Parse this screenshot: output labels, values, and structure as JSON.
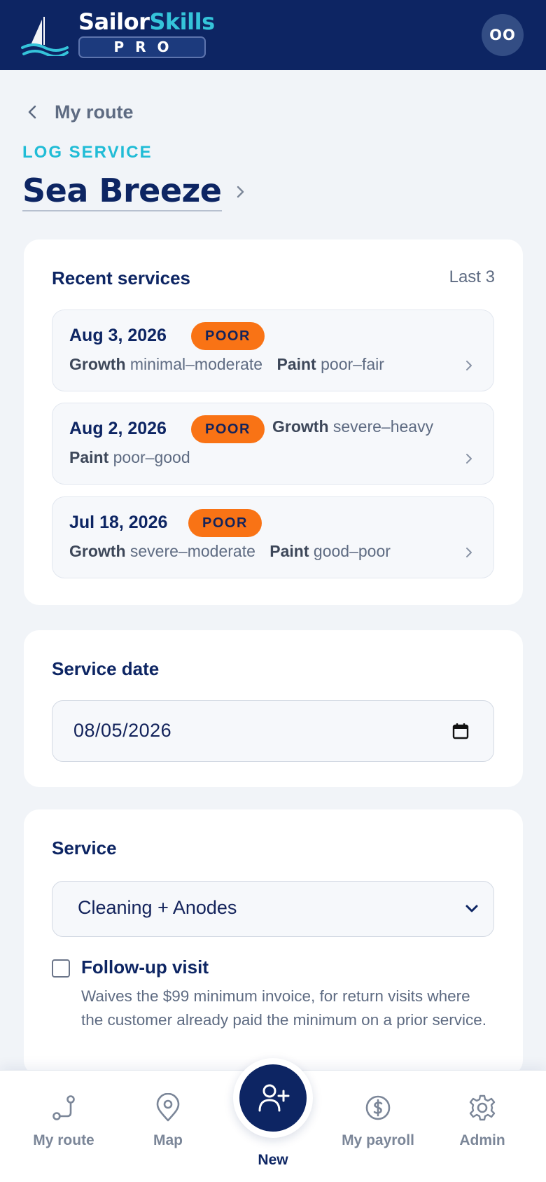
{
  "header": {
    "brand_part1": "Sailor",
    "brand_part2": "Skills",
    "tier": "PRO",
    "avatar_initials": "OO"
  },
  "nav": {
    "back_label": "My route"
  },
  "page": {
    "eyebrow": "LOG SERVICE",
    "boat_name": "Sea Breeze"
  },
  "recent": {
    "title": "Recent services",
    "meta": "Last 3",
    "items": [
      {
        "date": "Aug 3, 2026",
        "badge": "POOR",
        "growth_label": "Growth",
        "growth_value": "minimal–moderate",
        "paint_label": "Paint",
        "paint_value": "poor–fair"
      },
      {
        "date": "Aug 2, 2026",
        "badge": "POOR",
        "growth_label": "Growth",
        "growth_value": "severe–heavy",
        "paint_label": "Paint",
        "paint_value": "poor–good"
      },
      {
        "date": "Jul 18, 2026",
        "badge": "POOR",
        "growth_label": "Growth",
        "growth_value": "severe–moderate",
        "paint_label": "Paint",
        "paint_value": "good–poor"
      }
    ]
  },
  "service_date": {
    "title": "Service date",
    "value": "08/05/2026"
  },
  "service": {
    "title": "Service",
    "selected": "Cleaning + Anodes",
    "followup_label": "Follow-up visit",
    "followup_help": "Waives the $99 minimum invoice, for return visits where the customer already paid the minimum on a prior service.",
    "followup_checked": false
  },
  "bottom_nav": {
    "items": [
      {
        "label": "My route",
        "icon": "route-icon"
      },
      {
        "label": "Map",
        "icon": "map-pin-icon"
      },
      {
        "label": "New",
        "icon": "add-user-icon"
      },
      {
        "label": "My payroll",
        "icon": "dollar-coin-icon"
      },
      {
        "label": "Admin",
        "icon": "gear-icon"
      }
    ]
  },
  "colors": {
    "navy": "#0d2563",
    "accent_cyan": "#20bcd6",
    "badge_orange": "#f97315",
    "page_bg": "#f1f4f8"
  }
}
